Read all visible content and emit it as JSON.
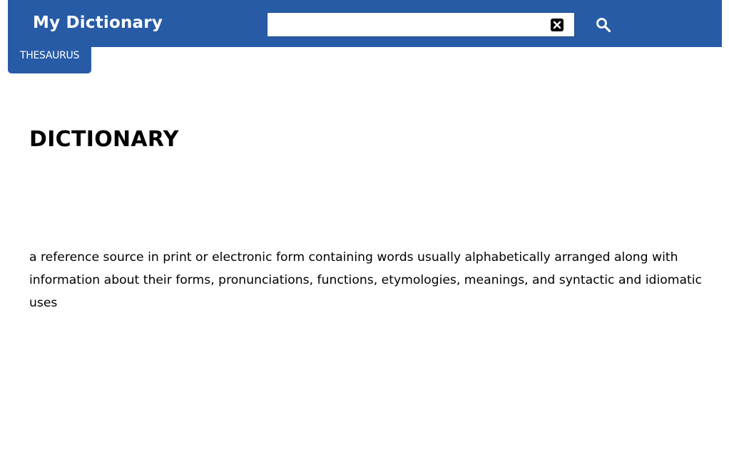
{
  "header": {
    "title": "My Dictionary",
    "background_color": "#285ba6"
  },
  "search": {
    "value": "",
    "placeholder": "",
    "clear_icon": "clear-x-icon",
    "submit_icon": "magnifier-search-icon"
  },
  "tabs": {
    "thesaurus_label": "THESAURUS"
  },
  "entry": {
    "word": "DICTIONARY",
    "definition": "a reference source in print or electronic form containing words usually alphabetically arranged along with information about their forms, pronunciations, functions, etymologies, meanings, and syntactic and idiomatic uses"
  }
}
